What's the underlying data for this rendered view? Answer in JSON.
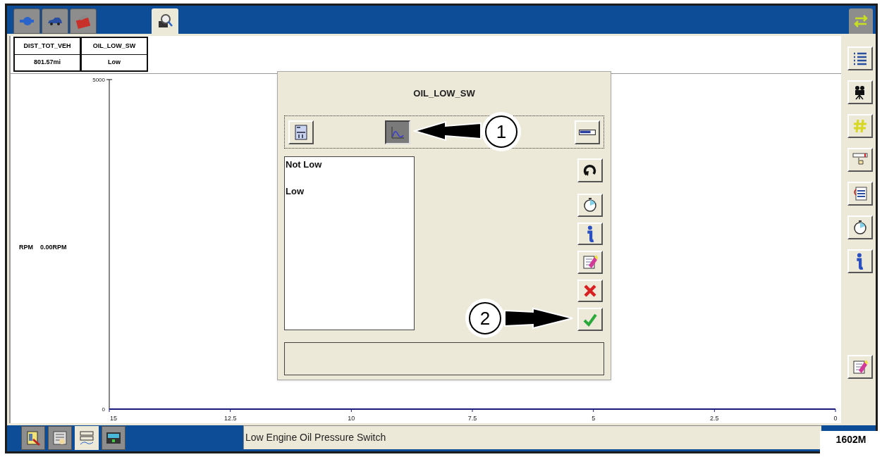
{
  "top_tabs": [
    {
      "selected": false
    },
    {
      "selected": false
    },
    {
      "selected": false
    },
    {
      "selected": true
    }
  ],
  "data_columns": [
    {
      "header": "DIST_TOT_VEH",
      "value": "801.57mi"
    },
    {
      "header": "OIL_LOW_SW",
      "value": "Low"
    }
  ],
  "chart": {
    "legend": {
      "label": "RPM",
      "reading": "0.00RPM"
    },
    "chart_data": {
      "type": "line",
      "xlim": [
        15,
        0
      ],
      "ylim": [
        0,
        5000
      ],
      "xticks": [
        15,
        {
          "value": 12.5,
          "label": "12.5"
        },
        10,
        {
          "value": 7.5,
          "label": "7.5"
        },
        5,
        {
          "value": 2.5,
          "label": "2.5"
        },
        0
      ],
      "yticks": [
        0,
        5000
      ]
    }
  },
  "dialog": {
    "title": "OIL_LOW_SW",
    "view_buttons": [
      {
        "selected": false
      },
      {
        "selected": true
      },
      {
        "selected": false
      }
    ],
    "states": [
      "Not Low",
      "Low"
    ],
    "callouts": [
      "1",
      "2"
    ]
  },
  "bottom_tabs": [
    {
      "selected": false
    },
    {
      "selected": false
    },
    {
      "selected": true
    },
    {
      "selected": false
    }
  ],
  "status_bar": {
    "text": "Low Engine Oil Pressure Switch"
  },
  "figure_label": "1602M"
}
